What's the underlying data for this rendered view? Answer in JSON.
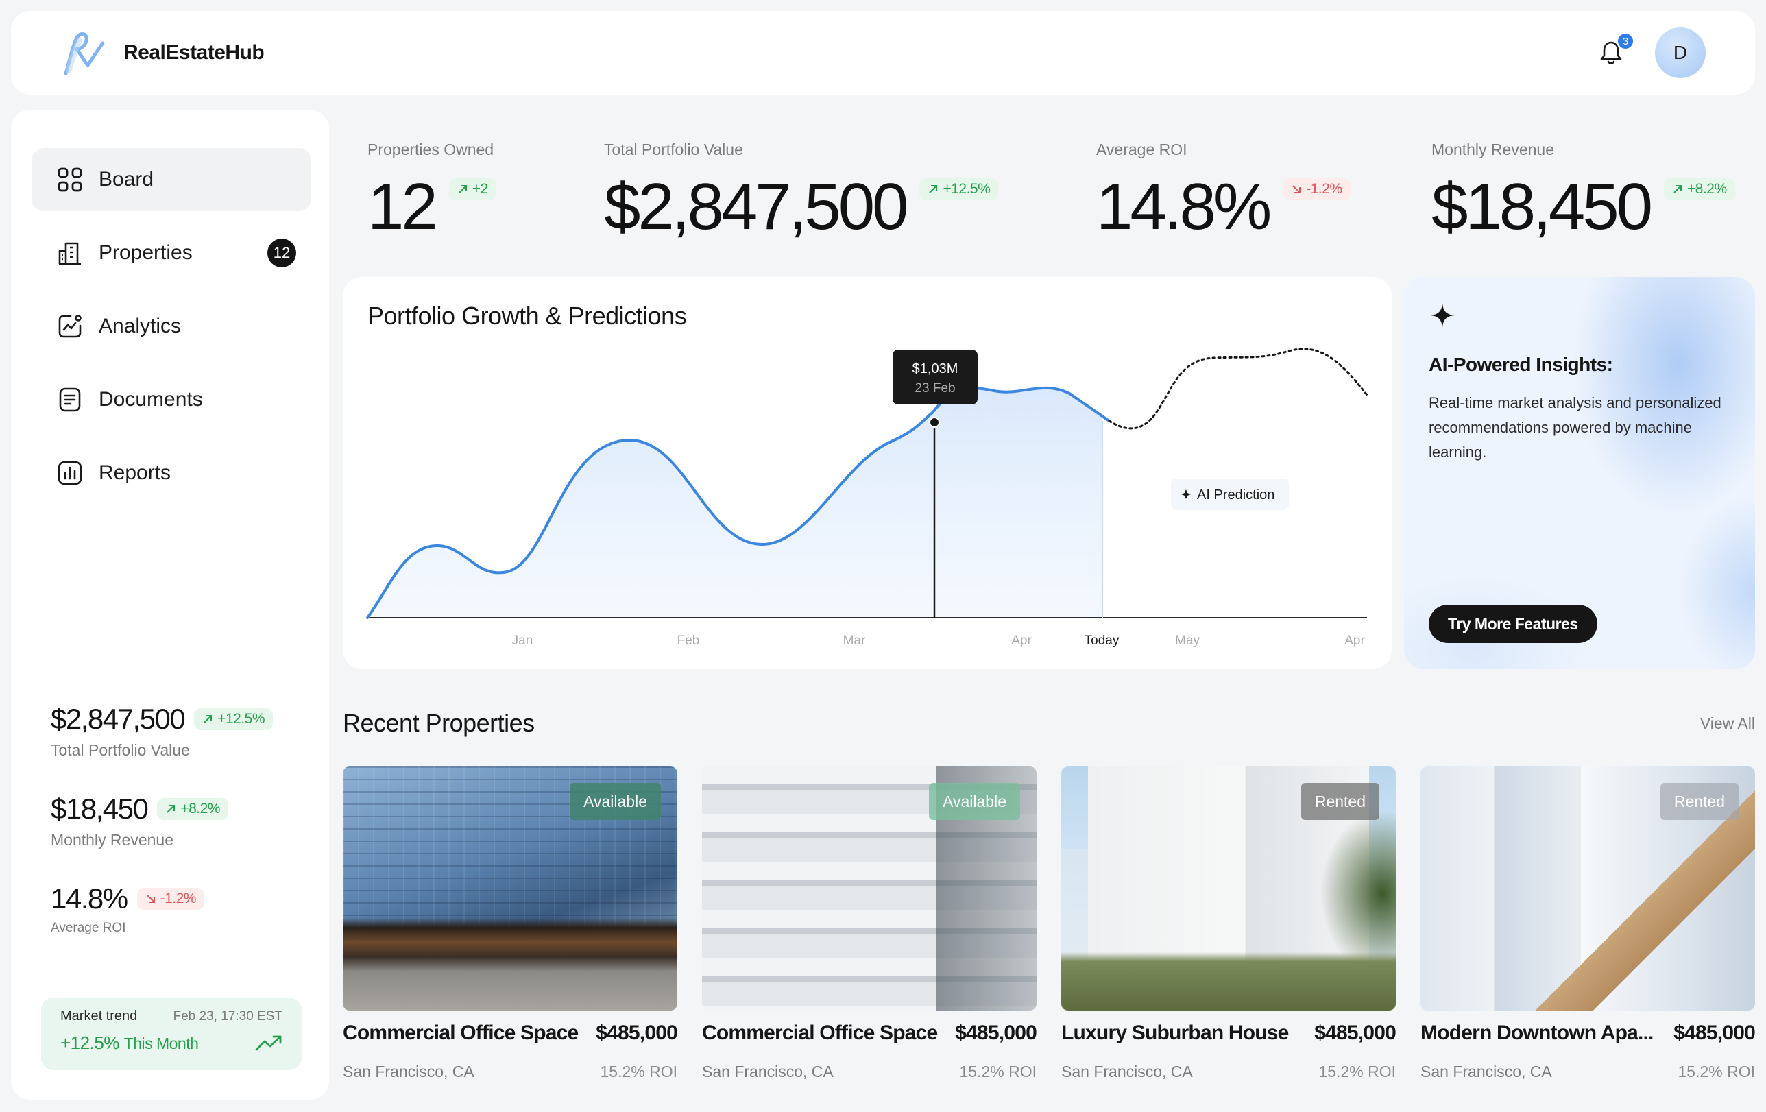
{
  "header": {
    "brand_name": "RealEstateHub",
    "notification_count": "3",
    "avatar_initial": "D"
  },
  "sidebar": {
    "items": [
      {
        "label": "Board",
        "icon": "grid-icon",
        "active": true
      },
      {
        "label": "Properties",
        "icon": "building-icon",
        "count": "12"
      },
      {
        "label": "Analytics",
        "icon": "analytics-icon"
      },
      {
        "label": "Documents",
        "icon": "document-icon"
      },
      {
        "label": "Reports",
        "icon": "bar-chart-icon"
      }
    ],
    "stats": [
      {
        "value": "$2,847,500",
        "change": "+12.5%",
        "direction": "up",
        "label": "Total Portfolio Value"
      },
      {
        "value": "$18,450",
        "change": "+8.2%",
        "direction": "up",
        "label": "Monthly Revenue"
      },
      {
        "value": "14.8%",
        "change": "-1.2%",
        "direction": "down",
        "label": "Average ROI"
      }
    ],
    "market": {
      "title": "Market trend",
      "date": "Feb 23, 17:30 EST",
      "value": "+12.5%",
      "suffix": "This Month"
    }
  },
  "kpis": [
    {
      "label": "Properties Owned",
      "value": "12",
      "change": "+2",
      "direction": "up"
    },
    {
      "label": "Total Portfolio Value",
      "value": "$2,847,500",
      "change": "+12.5%",
      "direction": "up"
    },
    {
      "label": "Average ROI",
      "value": "14.8%",
      "change": "-1.2%",
      "direction": "down"
    },
    {
      "label": "Monthly Revenue",
      "value": "$18,450",
      "change": "+8.2%",
      "direction": "up"
    }
  ],
  "chart": {
    "title": "Portfolio Growth & Predictions",
    "x_labels": [
      "Jan",
      "Feb",
      "Mar",
      "Apr",
      "Today",
      "May",
      "Apr"
    ],
    "tooltip_value": "$1,03M",
    "tooltip_date": "23 Feb",
    "prediction_label": "AI Prediction",
    "colors": {
      "line": "#3a86e0",
      "fill": "#e6f0fc",
      "prediction": "#161616"
    }
  },
  "ai": {
    "title": "AI-Powered Insights:",
    "description": "Real-time market analysis and personalized recommendations powered by machine learning.",
    "button": "Try More Features"
  },
  "recent": {
    "title": "Recent Properties",
    "view_all": "View All",
    "properties": [
      {
        "title": "Commercial Office Space",
        "price": "$485,000",
        "location": "San Francisco, CA",
        "roi": "15.2% ROI",
        "status": "Available"
      },
      {
        "title": "Commercial Office Space",
        "price": "$485,000",
        "location": "San Francisco, CA",
        "roi": "15.2% ROI",
        "status": "Available"
      },
      {
        "title": "Luxury Suburban House",
        "price": "$485,000",
        "location": "San Francisco, CA",
        "roi": "15.2% ROI",
        "status": "Rented"
      },
      {
        "title": "Modern Downtown Apa...",
        "price": "$485,000",
        "location": "San Francisco, CA",
        "roi": "15.2% ROI",
        "status": "Rented"
      }
    ]
  }
}
